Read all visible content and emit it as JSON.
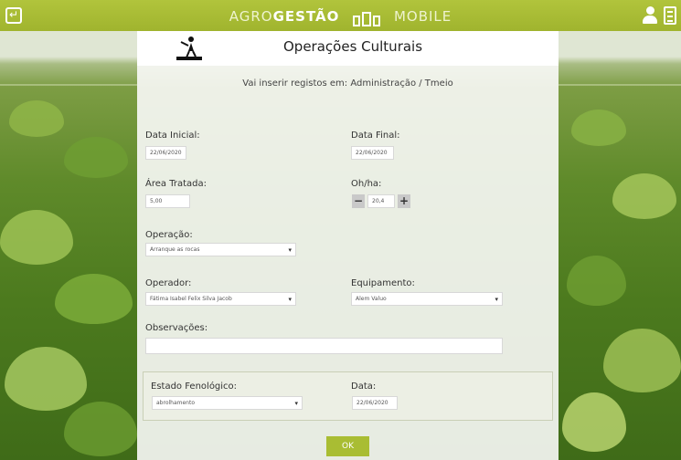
{
  "app": {
    "brand_thin": "AGRO",
    "brand_bold": "GESTÃO",
    "brand_suffix": "MOBILE"
  },
  "page": {
    "title": "Operações Culturais"
  },
  "form": {
    "info": "Vai inserir registos em: Administração / Tmeio",
    "start_date": {
      "label": "Data Inicial:",
      "value": "22/06/2020"
    },
    "end_date": {
      "label": "Data Final:",
      "value": "22/06/2020"
    },
    "area": {
      "label": "Área Tratada:",
      "value": "5,00"
    },
    "ohl": {
      "label": "Oh/ha:",
      "value": "20,4",
      "minus": "−",
      "plus": "+"
    },
    "operation": {
      "label": "Operação:",
      "value": "Arranque as rocas"
    },
    "operator": {
      "label": "Operador:",
      "value": "Fátima Isabel Felix Silva Jacob"
    },
    "equipment": {
      "label": "Equipamento:",
      "value": "Alem Valuo"
    },
    "notes": {
      "label": "Observações:",
      "value": ""
    },
    "phenology": {
      "label": "Estado Fenológico:",
      "value": "abrolhamento"
    },
    "date": {
      "label": "Data:",
      "value": "22/06/2020"
    },
    "ok_label": "OK"
  },
  "colors": {
    "accent": "#a9bd33",
    "header": "#a0b42e"
  },
  "icons": [
    "back-icon",
    "user-icon",
    "document-icon",
    "farmer-icon"
  ]
}
